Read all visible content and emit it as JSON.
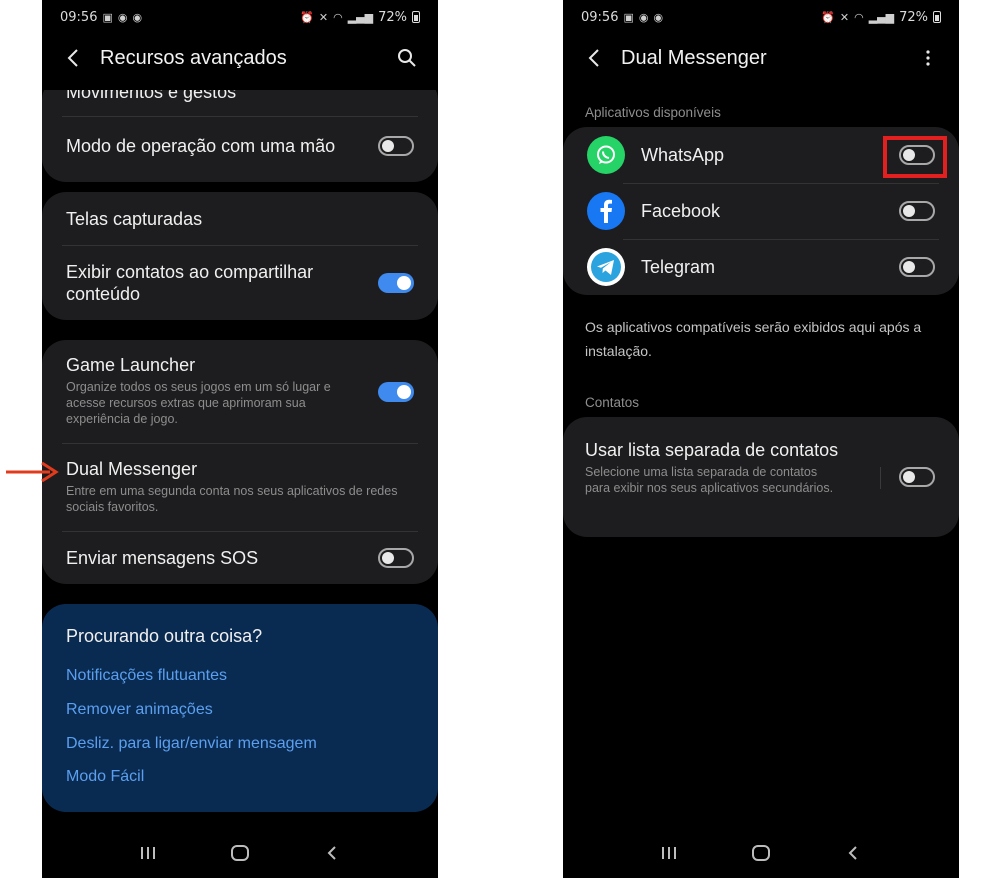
{
  "left_screen": {
    "status": {
      "time": "09:56",
      "battery": "72%"
    },
    "app_bar": {
      "title": "Recursos avançados"
    },
    "items": {
      "movements": {
        "title": "Movimentos e gestos"
      },
      "one_hand": {
        "title": "Modo de operação com uma mão",
        "enabled": false
      },
      "screenshots": {
        "title": "Telas capturadas"
      },
      "show_contacts": {
        "title": "Exibir contatos ao compartilhar conteúdo",
        "enabled": true
      },
      "game_launcher": {
        "title": "Game Launcher",
        "subtitle": "Organize todos os seus jogos em um só lugar e acesse recursos extras que aprimoram sua experiência de jogo.",
        "enabled": true
      },
      "dual_messenger": {
        "title": "Dual Messenger",
        "subtitle": "Entre em uma segunda conta nos seus aplicativos de redes sociais favoritos."
      },
      "sos": {
        "title": "Enviar mensagens SOS",
        "enabled": false
      }
    },
    "search_suggestions": {
      "title": "Procurando outra coisa?",
      "links": [
        "Notificações flutuantes",
        "Remover animações",
        "Desliz. para ligar/enviar mensagem",
        "Modo Fácil"
      ]
    }
  },
  "right_screen": {
    "status": {
      "time": "09:56",
      "battery": "72%"
    },
    "app_bar": {
      "title": "Dual Messenger"
    },
    "available_label": "Aplicativos disponíveis",
    "apps": [
      {
        "name": "WhatsApp",
        "icon": "whatsapp-icon",
        "enabled": false
      },
      {
        "name": "Facebook",
        "icon": "facebook-icon",
        "enabled": false
      },
      {
        "name": "Telegram",
        "icon": "telegram-icon",
        "enabled": false
      }
    ],
    "info": "Os aplicativos compatíveis serão exibidos aqui após a instalação.",
    "contacts_label": "Contatos",
    "contacts_option": {
      "title": "Usar lista separada de contatos",
      "subtitle": "Selecione uma lista separada de contatos para exibir nos seus aplicativos secundários.",
      "enabled": false
    }
  },
  "colors": {
    "accent": "#3e8aef",
    "highlight": "#e1201f",
    "arrow": "#e23a1c",
    "search_card": "#0a2b51",
    "link": "#5b9ff0"
  }
}
